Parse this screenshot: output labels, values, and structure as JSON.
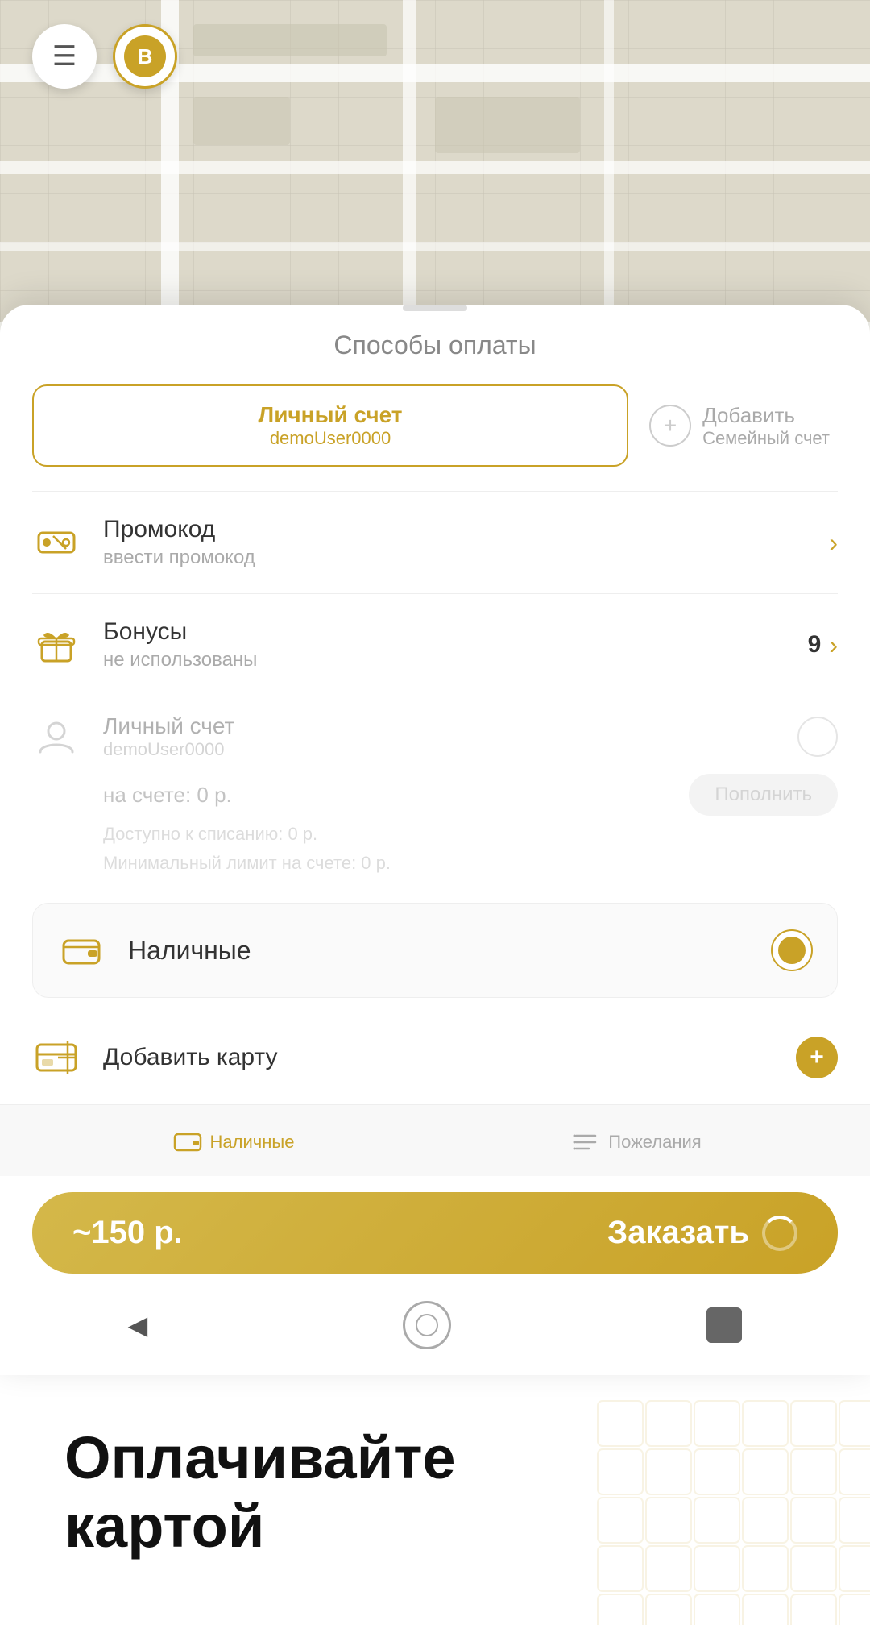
{
  "map": {
    "menu_icon": "☰",
    "b_label": "B"
  },
  "modal": {
    "handle_aria": "sheet handle",
    "title": "Способы оплаты",
    "account_tab": {
      "label": "Личный счет",
      "sub": "demoUser0000"
    },
    "add_tab": {
      "label": "Добавить",
      "sub": "Семейный счет"
    },
    "promo": {
      "icon_aria": "promo-icon",
      "title": "Промокод",
      "sub": "ввести промокод"
    },
    "bonus": {
      "icon_aria": "gift-icon",
      "title": "Бонусы",
      "sub": "не использованы",
      "count": "9"
    },
    "personal": {
      "icon_aria": "user-icon",
      "title": "Личный счет",
      "sub": "demoUser0000",
      "balance_label": "на счете: 0 р.",
      "refill_label": "Пополнить",
      "limit1": "Доступно к списанию: 0 р.",
      "limit2": "Минимальный лимит на счете: 0 р."
    },
    "cash": {
      "icon_aria": "wallet-icon",
      "label": "Наличные"
    },
    "add_card": {
      "icon_aria": "card-icon",
      "label": "Добавить карту"
    }
  },
  "bottom_bar": {
    "cash_icon_aria": "wallet-icon",
    "cash_label": "Наличные",
    "wishes_icon_aria": "list-icon",
    "wishes_label": "Пожелания"
  },
  "order_button": {
    "price": "~150 р.",
    "label": "Заказать"
  },
  "nav_bar": {
    "back_icon": "◀",
    "home_icon_aria": "home-button",
    "square_icon_aria": "recent-apps-button"
  },
  "promo_section": {
    "line1": "Оплачивайте",
    "line2": "картой"
  }
}
